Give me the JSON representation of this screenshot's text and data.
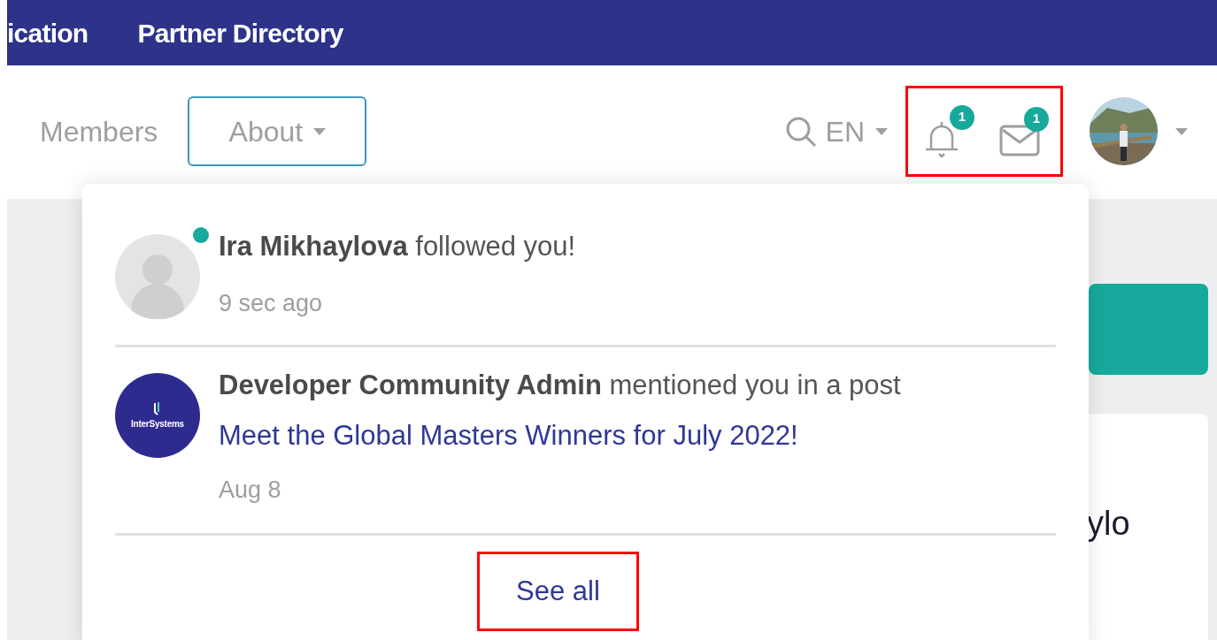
{
  "top_nav": {
    "items": [
      "ication",
      "Partner Directory"
    ]
  },
  "header": {
    "nav": [
      {
        "label": "Members",
        "kind": "link",
        "selected": false
      },
      {
        "label": "About",
        "kind": "dropdown",
        "selected": true
      }
    ],
    "language": "EN",
    "notifications": {
      "count": "1",
      "highlighted": true
    },
    "messages": {
      "count": "1"
    }
  },
  "background": {
    "card_text": "ylo"
  },
  "notifications_menu": {
    "items": [
      {
        "text": "**Ira Mikhaylova** followed you!",
        "time": "9 sec ago",
        "avatar": {
          "kind": "placeholder"
        },
        "online": true
      },
      {
        "text": "**Developer Community Admin** mentioned you in a post",
        "link": "Meet the Global Masters Winners for July 2022!",
        "time": "Aug 8",
        "avatar": {
          "kind": "logo",
          "text": "InterSystems"
        },
        "online": false
      }
    ],
    "see_all": {
      "label": "See all",
      "highlighted": true
    }
  }
}
